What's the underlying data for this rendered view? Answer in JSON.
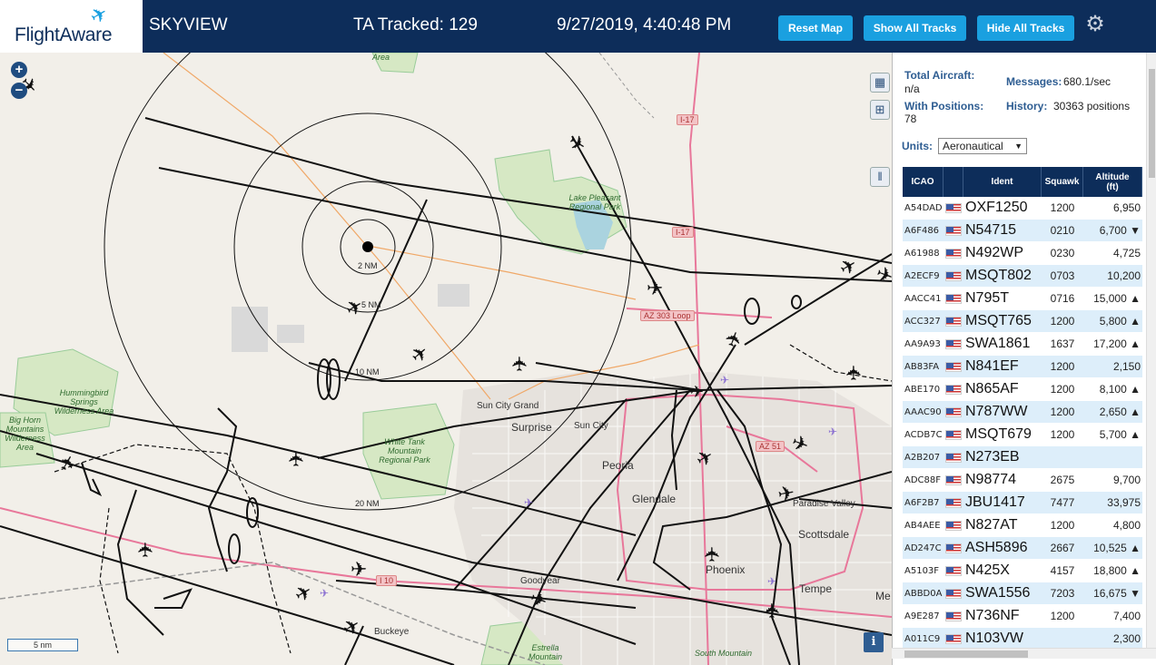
{
  "header": {
    "brand": "FlightAware",
    "site": "SKYVIEW",
    "tracked": "TA Tracked: 129",
    "datetime": "9/27/2019, 4:40:48 PM",
    "buttons": {
      "reset": "Reset Map",
      "show_all": "Show All Tracks",
      "hide_all": "Hide All Tracks"
    },
    "settings_icon": "gear-icon"
  },
  "map": {
    "zoom_in": "+",
    "zoom_out": "−",
    "scale": "5 nm",
    "info": "i",
    "rings": [
      "2 NM",
      "5 NM",
      "10 NM",
      "20 NM"
    ],
    "places": {
      "area": "Area",
      "hummingbird": "Hummingbird Springs Wilderness Area",
      "bighorn": "Big Horn Mountains Wilderness Area",
      "lake_pleasant": "Lake Pleasant Regional Park",
      "white_tank": "White Tank Mountain Regional Park",
      "sun_city_grand": "Sun City Grand",
      "surprise": "Surprise",
      "sun_city": "Sun City",
      "peoria": "Peoria",
      "glendale": "Glendale",
      "paradise_valley": "Paradise Valley",
      "scottsdale": "Scottsdale",
      "phoenix": "Phoenix",
      "tempe": "Tempe",
      "mesa": "Me",
      "goodyear": "Goodyear",
      "buckeye": "Buckeye",
      "estrella": "Estrella Mountain",
      "south_mountain": "South Mountain"
    },
    "shields": {
      "i17a": "I-17",
      "i17b": "I-17",
      "az303": "AZ 303 Loop",
      "az51": "AZ 51",
      "i10": "I 10"
    }
  },
  "stats": {
    "total_aircraft_label": "Total Aircraft:",
    "total_aircraft": "n/a",
    "messages_label": "Messages:",
    "messages": "680.1/sec",
    "with_positions_label": "With Positions:",
    "with_positions": "78",
    "history_label": "History:",
    "history": "30363 positions",
    "units_label": "Units:",
    "units": "Aeronautical"
  },
  "table": {
    "headers": {
      "icao": "ICAO",
      "ident": "Ident",
      "squawk": "Squawk",
      "altitude": "Altitude (ft)"
    },
    "rows": [
      {
        "icao": "A54DAD",
        "ident": "OXF1250",
        "squawk": "1200",
        "alt": "6,950"
      },
      {
        "icao": "A6F486",
        "ident": "N54715",
        "squawk": "0210",
        "alt": "6,700 ▼"
      },
      {
        "icao": "A61988",
        "ident": "N492WP",
        "squawk": "0230",
        "alt": "4,725"
      },
      {
        "icao": "A2ECF9",
        "ident": "MSQT802",
        "squawk": "0703",
        "alt": "10,200"
      },
      {
        "icao": "AACC41",
        "ident": "N795T",
        "squawk": "0716",
        "alt": "15,000 ▲"
      },
      {
        "icao": "ACC327",
        "ident": "MSQT765",
        "squawk": "1200",
        "alt": "5,800 ▲"
      },
      {
        "icao": "AA9A93",
        "ident": "SWA1861",
        "squawk": "1637",
        "alt": "17,200 ▲"
      },
      {
        "icao": "AB83FA",
        "ident": "N841EF",
        "squawk": "1200",
        "alt": "2,150"
      },
      {
        "icao": "ABE170",
        "ident": "N865AF",
        "squawk": "1200",
        "alt": "8,100 ▲"
      },
      {
        "icao": "AAAC90",
        "ident": "N787WW",
        "squawk": "1200",
        "alt": "2,650 ▲"
      },
      {
        "icao": "ACDB7C",
        "ident": "MSQT679",
        "squawk": "1200",
        "alt": "5,700 ▲"
      },
      {
        "icao": "A2B207",
        "ident": "N273EB",
        "squawk": "",
        "alt": ""
      },
      {
        "icao": "ADC88F",
        "ident": "N98774",
        "squawk": "2675",
        "alt": "9,700"
      },
      {
        "icao": "A6F2B7",
        "ident": "JBU1417",
        "squawk": "7477",
        "alt": "33,975"
      },
      {
        "icao": "AB4AEE",
        "ident": "N827AT",
        "squawk": "1200",
        "alt": "4,800"
      },
      {
        "icao": "AD247C",
        "ident": "ASH5896",
        "squawk": "2667",
        "alt": "10,525 ▲"
      },
      {
        "icao": "A5103F",
        "ident": "N425X",
        "squawk": "4157",
        "alt": "18,800 ▲"
      },
      {
        "icao": "ABBD0A",
        "ident": "SWA1556",
        "squawk": "7203",
        "alt": "16,675 ▼"
      },
      {
        "icao": "A9E287",
        "ident": "N736NF",
        "squawk": "1200",
        "alt": "7,400"
      },
      {
        "icao": "A011C9",
        "ident": "N103VW",
        "squawk": "",
        "alt": "2,300"
      }
    ]
  },
  "colors": {
    "header_bg": "#0d2d5a",
    "button": "#1aa0e0",
    "label": "#2e5d92",
    "row_alt": "#ddeefa"
  }
}
